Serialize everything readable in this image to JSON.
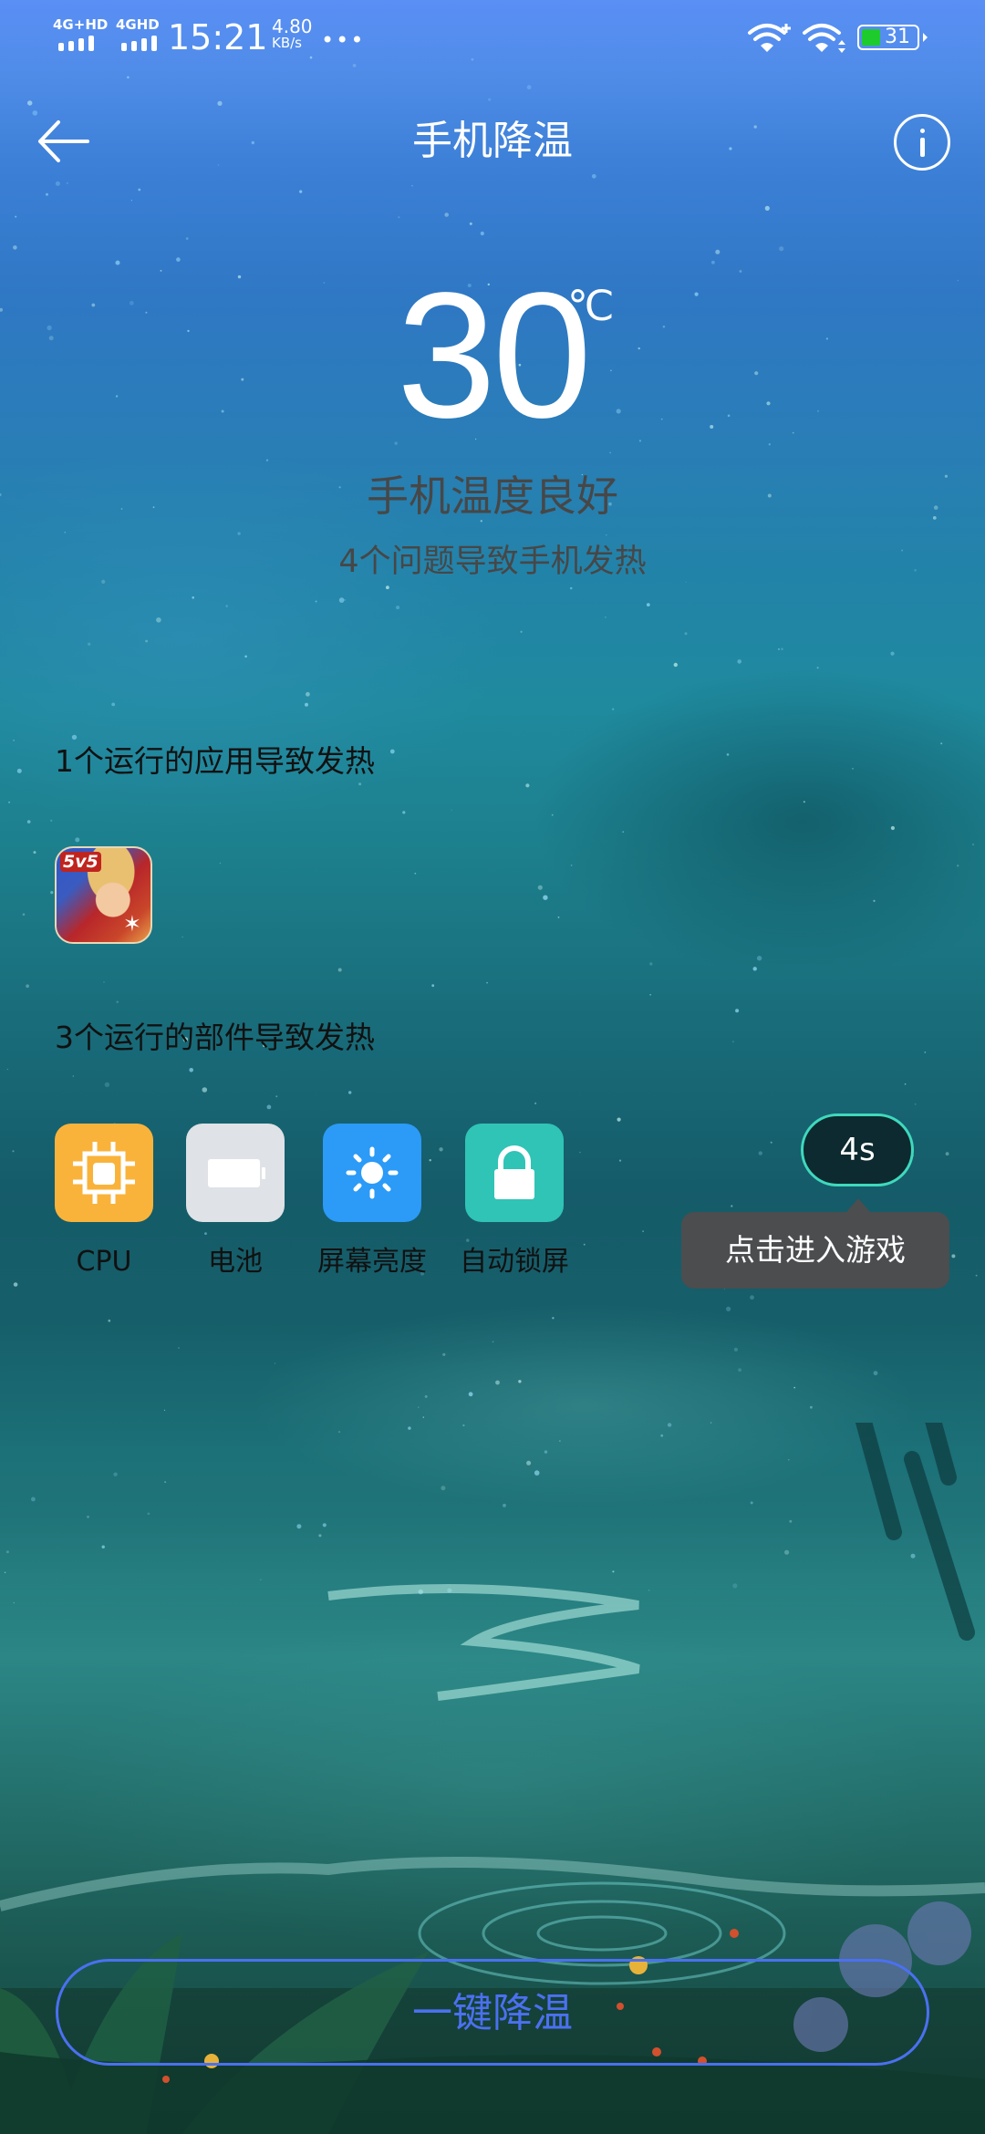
{
  "status_bar": {
    "sim1_label": "4G+HD",
    "sim2_label": "4GHD",
    "time": "15:21",
    "net_speed_value": "4.80",
    "net_speed_unit": "KB/s",
    "more": "•••",
    "battery_level": "31",
    "icons": [
      "signal-icon",
      "signal-icon",
      "wifi-plus-icon",
      "wifi-icon",
      "battery-icon"
    ]
  },
  "header": {
    "back_icon": "back-arrow-icon",
    "title": "手机降温",
    "info_icon": "info-icon"
  },
  "temperature": {
    "value": "30",
    "unit": "℃",
    "status": "手机温度良好",
    "issues_summary": "4个问题导致手机发热"
  },
  "apps_section": {
    "heading": "1个运行的应用导致发热",
    "apps": [
      {
        "name": "game-app",
        "badge": "5v5",
        "icon": "game-app-icon"
      }
    ]
  },
  "components_section": {
    "heading": "3个运行的部件导致发热",
    "items": [
      {
        "label": "CPU",
        "icon": "cpu-chip-icon",
        "color": "#f9b33b"
      },
      {
        "label": "电池",
        "icon": "battery-icon",
        "color": "#dfe2e6"
      },
      {
        "label": "屏幕亮度",
        "icon": "brightness-sun-icon",
        "color": "#2c9af7"
      },
      {
        "label": "自动锁屏",
        "icon": "lock-icon",
        "color": "#2fc4b6"
      }
    ]
  },
  "floating": {
    "countdown": "4s",
    "tooltip": "点击进入游戏"
  },
  "footer": {
    "cool_button_label": "一键降温",
    "accent_color": "#4b70f0"
  }
}
